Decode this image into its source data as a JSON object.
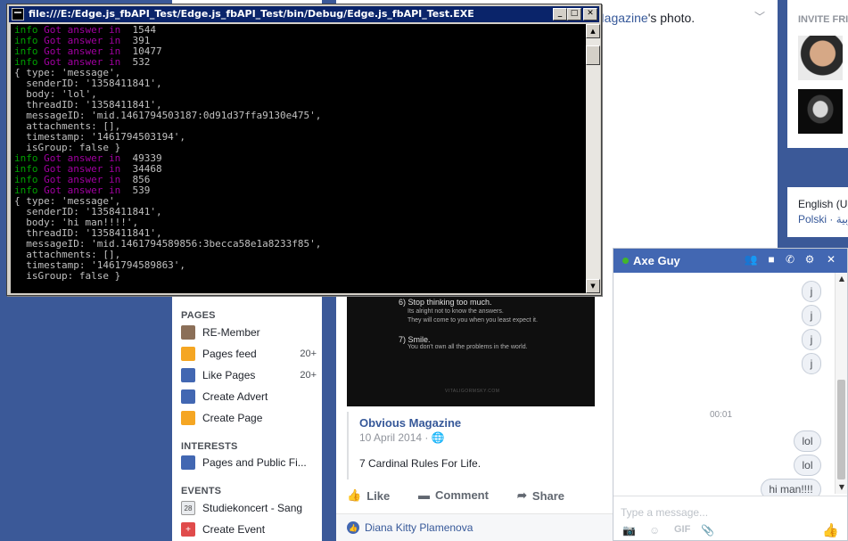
{
  "console": {
    "title": "file:///E:/Edge.js_fbAPI_Test/Edge.js_fbAPI_Test/bin/Debug/Edge.js_fbAPI_Test.EXE",
    "buttons": {
      "minimize": "_",
      "maximize": "□",
      "close": "✕"
    },
    "lines": [
      {
        "kind": "info",
        "tag": "info",
        "msg": "Got answer in",
        "value": "1544"
      },
      {
        "kind": "info",
        "tag": "info",
        "msg": "Got answer in",
        "value": "391"
      },
      {
        "kind": "info",
        "tag": "info",
        "msg": "Got answer in",
        "value": "10477"
      },
      {
        "kind": "info",
        "tag": "info",
        "msg": "Got answer in",
        "value": "532"
      },
      {
        "kind": "text",
        "text": "{ type: 'message',"
      },
      {
        "kind": "text",
        "text": "  senderID: '1358411841',"
      },
      {
        "kind": "text",
        "text": "  body: 'lol',"
      },
      {
        "kind": "text",
        "text": "  threadID: '1358411841',"
      },
      {
        "kind": "text",
        "text": "  messageID: 'mid.1461794503187:0d91d37ffa9130e475',"
      },
      {
        "kind": "text",
        "text": "  attachments: [],"
      },
      {
        "kind": "text",
        "text": "  timestamp: '1461794503194',"
      },
      {
        "kind": "text",
        "text": "  isGroup: false }"
      },
      {
        "kind": "info",
        "tag": "info",
        "msg": "Got answer in",
        "value": "49339"
      },
      {
        "kind": "info",
        "tag": "info",
        "msg": "Got answer in",
        "value": "34468"
      },
      {
        "kind": "info",
        "tag": "info",
        "msg": "Got answer in",
        "value": "856"
      },
      {
        "kind": "info",
        "tag": "info",
        "msg": "Got answer in",
        "value": "539"
      },
      {
        "kind": "text",
        "text": "{ type: 'message',"
      },
      {
        "kind": "text",
        "text": "  senderID: '1358411841',"
      },
      {
        "kind": "text",
        "text": "  body: 'hi man!!!!',"
      },
      {
        "kind": "text",
        "text": "  threadID: '1358411841',"
      },
      {
        "kind": "text",
        "text": "  messageID: 'mid.1461794589856:3becca58e1a8233f85',"
      },
      {
        "kind": "text",
        "text": "  attachments: [],"
      },
      {
        "kind": "text",
        "text": "  timestamp: '1461794589863',"
      },
      {
        "kind": "text",
        "text": "  isGroup: false }"
      }
    ]
  },
  "sidebar": {
    "pages_title": "PAGES",
    "pages_items": [
      {
        "label": "RE-Member",
        "count": "",
        "icon": "page-thumbnail-icon",
        "color": "#8b6f58"
      },
      {
        "label": "Pages feed",
        "count": "20+",
        "icon": "flag-icon",
        "color": "#f5a623"
      },
      {
        "label": "Like Pages",
        "count": "20+",
        "icon": "thumbs-up-icon",
        "color": "#4267b2"
      },
      {
        "label": "Create Advert",
        "count": "",
        "icon": "megaphone-icon",
        "color": "#4267b2"
      },
      {
        "label": "Create Page",
        "count": "",
        "icon": "flag-icon",
        "color": "#f5a623"
      }
    ],
    "interests_title": "INTERESTS",
    "interests_items": [
      {
        "label": "Pages and Public Fi...",
        "count": "",
        "icon": "news-feed-icon",
        "color": "#4267b2"
      }
    ],
    "events_title": "EVENTS",
    "events_items": [
      {
        "label": "Studiekoncert - Sang",
        "count": "",
        "icon": "calendar-icon",
        "color": "#e9ebee",
        "glyph": "28"
      },
      {
        "label": "Create Event",
        "count": "",
        "icon": "plus-icon",
        "color": "#e04b4b",
        "glyph": "+"
      }
    ]
  },
  "feed": {
    "header_link": "Magazine",
    "header_suffix": "'s photo.",
    "image_text": {
      "rule6": "6) Stop thinking too much.",
      "rule6_sub1": "Its alright not to know the answers.",
      "rule6_sub2": "They will come to you when you least expect it.",
      "rule7": "7) Smile.",
      "rule7_sub": "You don't own all the problems in the world.",
      "watermark": "VITALIGORMSKY.COM"
    },
    "shared_title": "Obvious Magazine",
    "shared_date": "10 April 2014",
    "shared_caption": "7 Cardinal Rules For Life.",
    "actions": {
      "like": "Like",
      "comment": "Comment",
      "share": "Share"
    },
    "liker": "Diana Kitty Plamenova"
  },
  "right": {
    "invite_title": "INVITE FRI",
    "lang_current": "English (UK",
    "lang_alt": "Polski · العربية"
  },
  "chat": {
    "name": "Axe Guy",
    "messages": [
      "j",
      "j",
      "j",
      "j"
    ],
    "timestamp": "00:01",
    "messages2": [
      "lol",
      "lol",
      "hi man!!!!"
    ],
    "placeholder": "Type a message...",
    "tools": {
      "gif": "GIF"
    },
    "accent": "#4267b2"
  }
}
